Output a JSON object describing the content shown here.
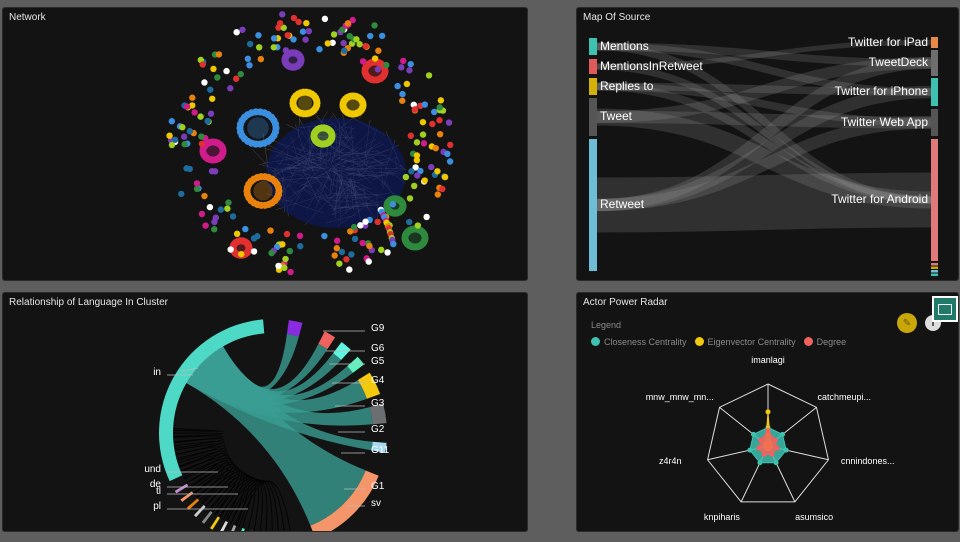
{
  "panels": {
    "network": {
      "title": "Network"
    },
    "sankey": {
      "title": "Map Of Source",
      "sources": [
        {
          "label": "Mentions",
          "color": "#3ec1b1"
        },
        {
          "label": "MentionsInRetweet",
          "color": "#e05a5a"
        },
        {
          "label": "Replies to",
          "color": "#d4b106"
        },
        {
          "label": "Tweet",
          "color": "#555555"
        },
        {
          "label": "Retweet",
          "color": "#6fbcd6"
        }
      ],
      "targets": [
        {
          "label": "Twitter for iPad",
          "color": "#e8894a"
        },
        {
          "label": "TweetDeck",
          "color": "#6e6e6e"
        },
        {
          "label": "Twitter for iPhone",
          "color": "#3ec1b1"
        },
        {
          "label": "Twitter Web App",
          "color": "#555555"
        },
        {
          "label": "Twitter for Android",
          "color": "#e07a7a"
        }
      ]
    },
    "chord": {
      "title": "Relationship of Language In Cluster",
      "left_labels": [
        "in",
        "und",
        "de",
        "tl",
        "pl"
      ],
      "right_labels": [
        "G9",
        "G6",
        "G5",
        "G4",
        "G3",
        "G2",
        "G11",
        "G1",
        "sv"
      ],
      "colors": {
        "in": "#4dd9c6",
        "G1": "#f4956a",
        "G3": "#f2c811",
        "G2": "#6b6f72",
        "G4": "#5ef2c0",
        "G5": "#5ff5e0",
        "G6": "#f0625d",
        "G9": "#8a2be2",
        "G11": "#a6d8f0",
        "link": "#3a9e94"
      }
    },
    "radar": {
      "title": "Actor Power Radar",
      "legend_title": "Legend",
      "series": [
        {
          "name": "Closeness Centrality",
          "color": "#3ec1b1",
          "values": [
            0.3,
            0.3,
            0.3,
            0.3,
            0.3,
            0.3,
            0.3
          ]
        },
        {
          "name": "Eigenvector Centrality",
          "color": "#f2c811",
          "values": [
            0.55,
            0.05,
            0.05,
            0.05,
            0.05,
            0.05,
            0.05
          ]
        },
        {
          "name": "Degree",
          "color": "#f0625d",
          "values": [
            0.25,
            0.15,
            0.15,
            0.15,
            0.15,
            0.15,
            0.15
          ]
        }
      ],
      "axes": [
        "imanlagi",
        "catchmeupi...",
        "cnnindones...",
        "asumsico",
        "knpiharis",
        "z4r4n",
        "mnw_mnw_mn..."
      ]
    }
  }
}
